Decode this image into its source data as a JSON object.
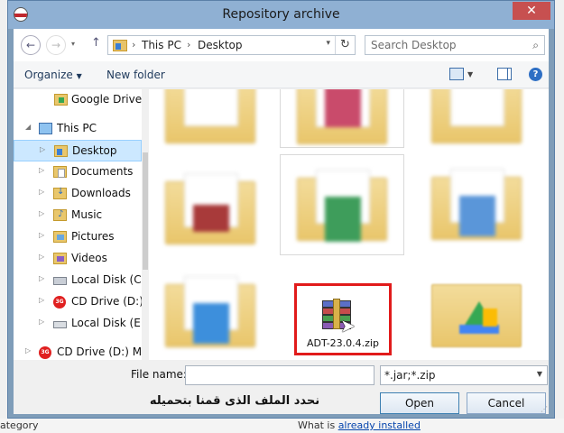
{
  "window": {
    "title": "Repository archive",
    "close_symbol": "✕"
  },
  "address": {
    "crumbs": [
      "This PC",
      "Desktop"
    ],
    "search_placeholder": "Search Desktop"
  },
  "toolbar": {
    "organize": "Organize",
    "new_folder": "New folder"
  },
  "tree": {
    "items": [
      {
        "label": "Google Drive",
        "icon": "google-drive-icon"
      },
      {
        "label": "This PC",
        "icon": "computer-icon"
      },
      {
        "label": "Desktop",
        "icon": "desktop-folder-icon",
        "selected": true
      },
      {
        "label": "Documents",
        "icon": "documents-folder-icon"
      },
      {
        "label": "Downloads",
        "icon": "downloads-folder-icon"
      },
      {
        "label": "Music",
        "icon": "music-folder-icon"
      },
      {
        "label": "Pictures",
        "icon": "pictures-folder-icon"
      },
      {
        "label": "Videos",
        "icon": "videos-folder-icon"
      },
      {
        "label": "Local Disk (C:)",
        "icon": "hard-disk-icon"
      },
      {
        "label": "CD Drive (D:) M",
        "icon": "cd-drive-icon"
      },
      {
        "label": "Local Disk (E:)",
        "icon": "optical-disk-icon"
      },
      {
        "label": "CD Drive (D:) Mol",
        "icon": "cd-drive-icon"
      }
    ]
  },
  "files": {
    "selected_file": "ADT-23.0.4.zip"
  },
  "footer": {
    "file_name_label": "File name:",
    "file_name_value": "",
    "filter": "*.jar;*.zip",
    "caption": "نحدد الملف الذى قمنا بتحميله",
    "open": "Open",
    "cancel": "Cancel"
  },
  "background": {
    "left_text": "ategory",
    "right_text_prefix": "What is",
    "right_link": "already installed"
  },
  "colors": {
    "titlebar": "#8fb0d3",
    "close": "#c75050",
    "highlight_border": "#e11b1b",
    "selection": "#cce8ff"
  }
}
